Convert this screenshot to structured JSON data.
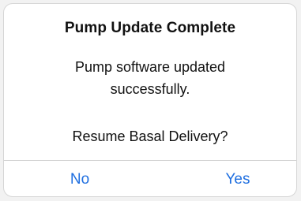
{
  "dialog": {
    "title": "Pump Update Complete",
    "message_line1": "Pump software updated",
    "message_line2": "successfully.",
    "question": "Resume Basal Delivery?",
    "buttons": {
      "no": "No",
      "yes": "Yes"
    }
  },
  "colors": {
    "accent": "#1f6fe0",
    "background": "#ffffff",
    "text": "#111111",
    "divider": "#cfcfcf"
  }
}
